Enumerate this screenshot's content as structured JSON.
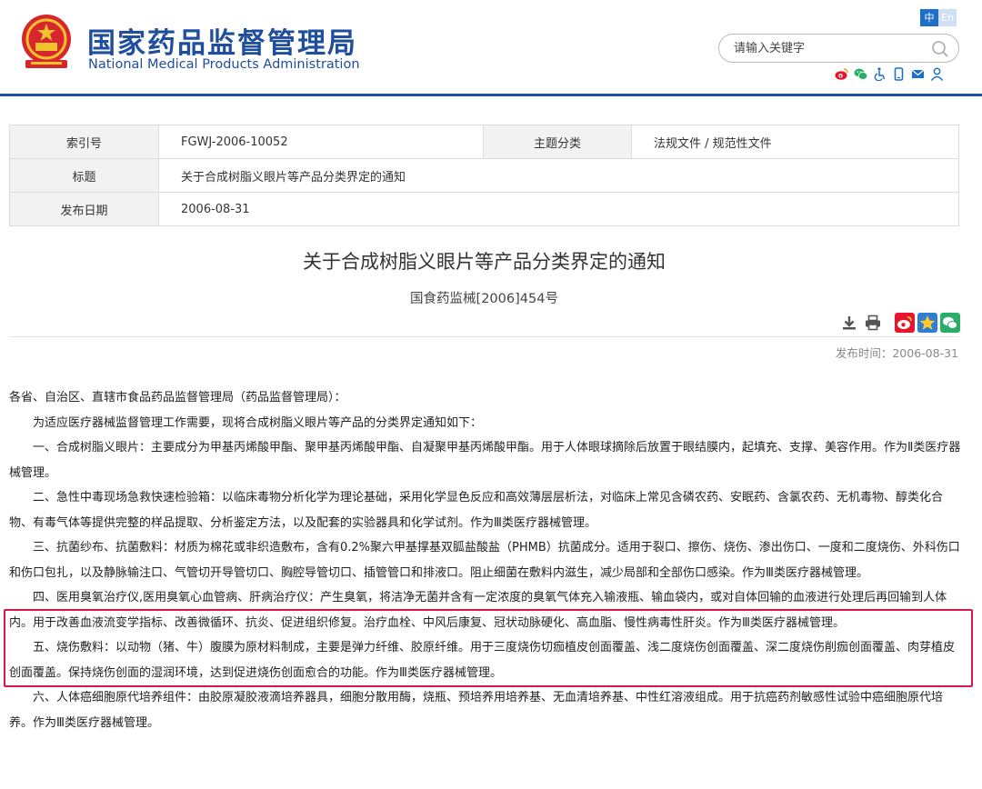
{
  "header": {
    "title_cn": "国家药品监督管理局",
    "title_en": "National Medical Products Administration",
    "lang_zh": "中",
    "lang_en": "En"
  },
  "search": {
    "placeholder": "请输入关键字"
  },
  "meta": {
    "index_label": "索引号",
    "index_value": "FGWJ-2006-10052",
    "category_label": "主题分类",
    "category_value": "法规文件 / 规范性文件",
    "title_label": "标题",
    "title_value": "关于合成树脂义眼片等产品分类界定的通知",
    "date_label": "发布日期",
    "date_value": "2006-08-31"
  },
  "document": {
    "title": "关于合成树脂义眼片等产品分类界定的通知",
    "number": "国食药监械[2006]454号",
    "publish_time": "发布时间：2006-08-31",
    "salutation": "各省、自治区、直辖市食品药品监督管理局（药品监督管理局）：",
    "intro": "为适应医疗器械监督管理工作需要，现将合成树脂义眼片等产品的分类界定通知如下：",
    "items": [
      "一、合成树脂义眼片：主要成分为甲基丙烯酸甲酯、聚甲基丙烯酸甲酯、自凝聚甲基丙烯酸甲酯。用于人体眼球摘除后放置于眼结膜内，起填充、支撑、美容作用。作为Ⅱ类医疗器械管理。",
      "二、急性中毒现场急救快速检验箱：以临床毒物分析化学为理论基础，采用化学显色反应和高效薄层层析法，对临床上常见含磷农药、安眠药、含氯农药、无机毒物、醇类化合物、有毒气体等提供完整的样品提取、分析鉴定方法，以及配套的实验器具和化学试剂。作为Ⅲ类医疗器械管理。",
      "三、抗菌纱布、抗菌敷料：材质为棉花或非织造敷布，含有0.2%聚六甲基撑基双胍盐酸盐（PHMB）抗菌成分。适用于裂口、擦伤、烧伤、渗出伤口、一度和二度烧伤、外科伤口和伤口包扎，以及静脉输注口、气管切开导管切口、胸腔导管切口、插管管口和排液口。阻止细菌在敷料内滋生，减少局部和全部伤口感染。作为Ⅲ类医疗器械管理。",
      "四、医用臭氧治疗仪,医用臭氧心血管病、肝病治疗仪：产生臭氧，将洁净无菌并含有一定浓度的臭氧气体充入输液瓶、输血袋内，或对自体回输的血液进行处理后再回输到人体内。用于改善血液流变学指标、改善微循环、抗炎、促进组织修复。治疗血栓、中风后康复、冠状动脉硬化、高血脂、慢性病毒性肝炎。作为Ⅲ类医疗器械管理。",
      "五、烧伤敷料：以动物（猪、牛）腹膜为原材料制成，主要是弹力纤维、胶原纤维。用于三度烧伤切痂植皮创面覆盖、浅二度烧伤创面覆盖、深二度烧伤削痂创面覆盖、肉芽植皮创面覆盖。保持烧伤创面的湿润环境，达到促进烧伤创面愈合的功能。作为Ⅲ类医疗器械管理。",
      "六、人体癌细胞原代培养组件：由胶原凝胶液滴培养器具，细胞分散用酶，烧瓶、预培养用培养基、无血清培养基、中性红溶液组成。用于抗癌药剂敏感性试验中癌细胞原代培养。作为Ⅲ类医疗器械管理。"
    ]
  },
  "colors": {
    "brand_blue": "#1f4e9c",
    "highlight_red": "#d4184f"
  },
  "icons": {
    "toolbar": [
      "weibo-icon",
      "wechat-icon",
      "accessibility-icon",
      "mobile-icon",
      "mail-icon",
      "user-icon"
    ],
    "actions": [
      "download-icon",
      "print-icon"
    ],
    "share": [
      "share-weibo-icon",
      "share-qzone-icon",
      "share-wechat-icon"
    ]
  }
}
